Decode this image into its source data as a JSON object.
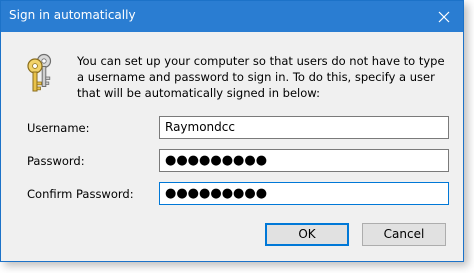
{
  "window": {
    "title": "Sign in automatically"
  },
  "description": "You can set up your computer so that users do not have to type a username and password to sign in. To do this, specify a user that will be automatically signed in below:",
  "form": {
    "username_label": "Username:",
    "username_value": "Raymondcc",
    "password_label": "Password:",
    "password_value": "●●●●●●●●●",
    "confirm_label": "Confirm Password:",
    "confirm_value": "●●●●●●●●●"
  },
  "buttons": {
    "ok_label": "OK",
    "cancel_label": "Cancel"
  },
  "icons": {
    "title_icon": "none",
    "close_icon": "close-icon",
    "main_icon": "keys-icon"
  },
  "colors": {
    "titlebar": "#2a7dd2",
    "dialog_bg": "#f0f0f0",
    "focus_border": "#0078d7"
  }
}
